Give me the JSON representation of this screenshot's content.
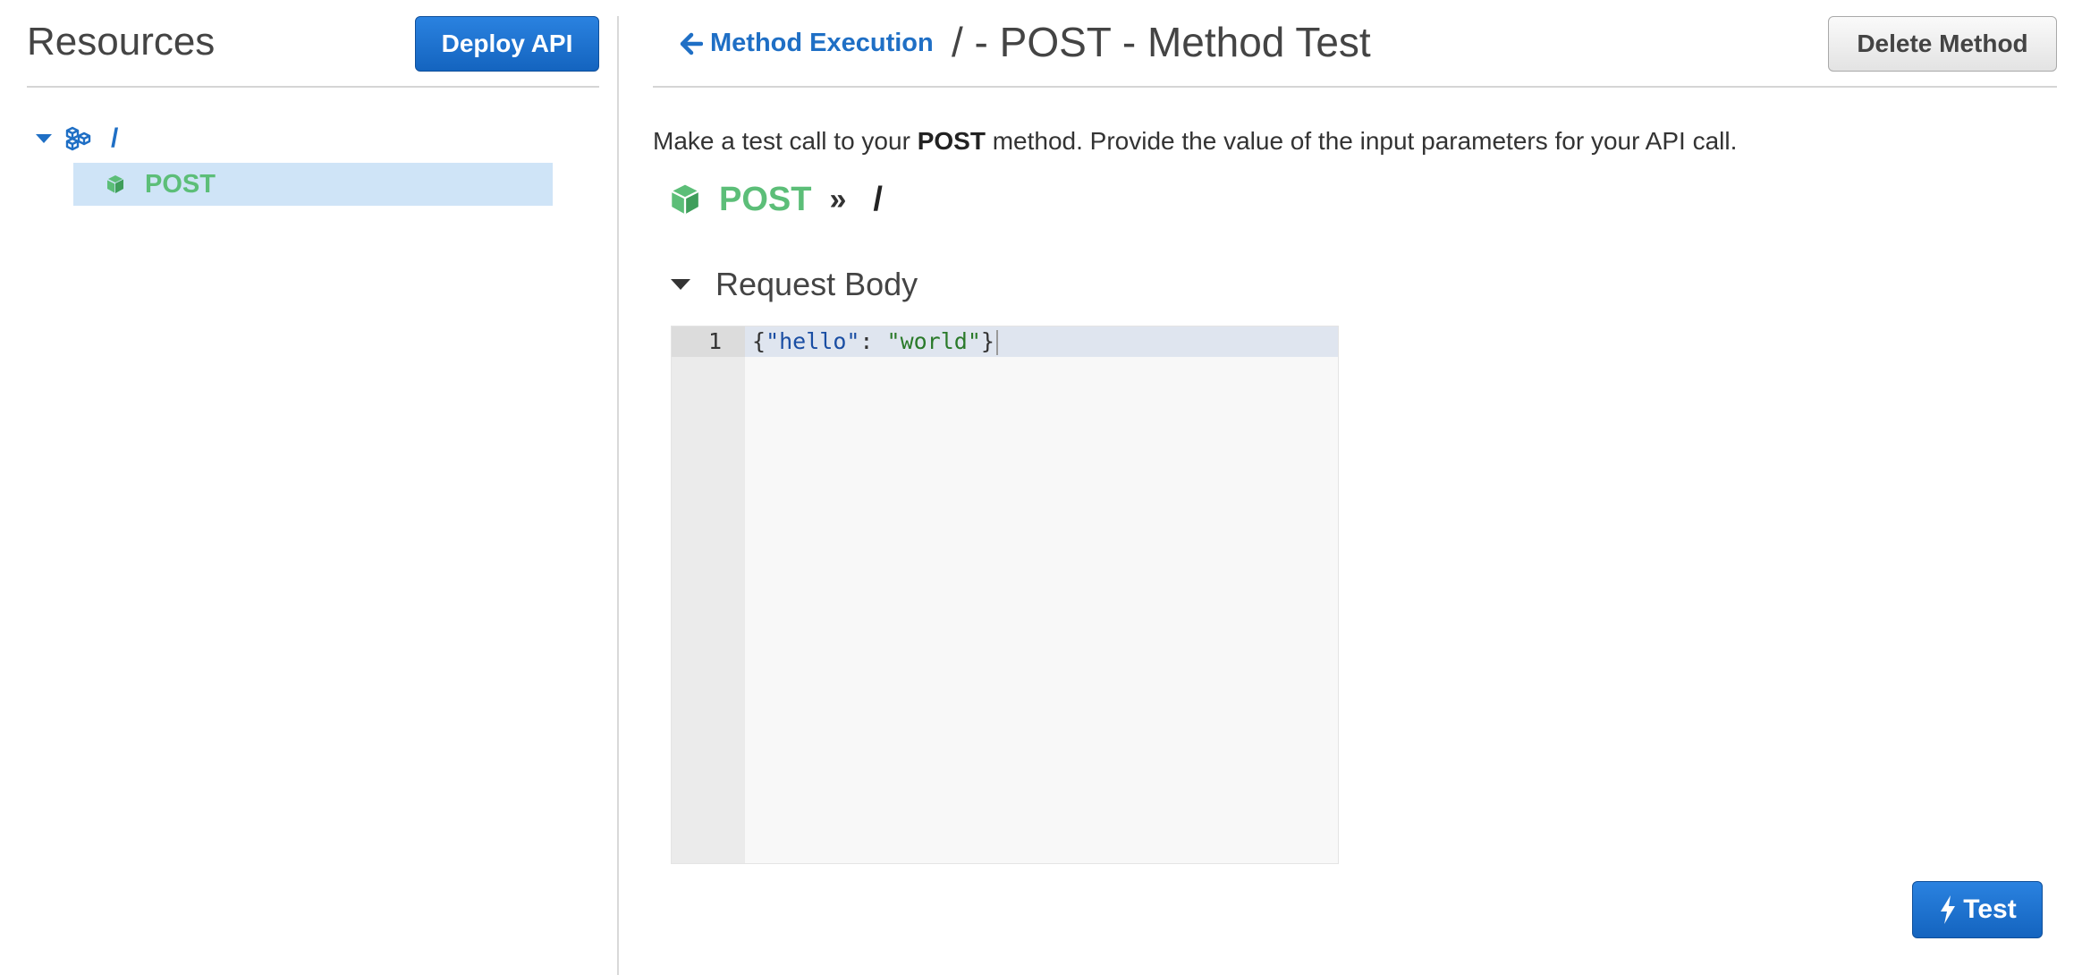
{
  "sidebar": {
    "title": "Resources",
    "deploy_button": "Deploy API",
    "tree": {
      "root": {
        "label": "/",
        "icon": "resources-cubes-icon",
        "expanded": true
      },
      "children": [
        {
          "label": "POST",
          "icon": "method-cube-icon",
          "selected": true
        }
      ]
    }
  },
  "header": {
    "back_link": "Method Execution",
    "title": "/ - POST - Method Test",
    "delete_button": "Delete Method"
  },
  "intro": {
    "prefix": "Make a test call to your ",
    "method": "POST",
    "suffix": " method. Provide the value of the input parameters for your API call."
  },
  "method_path": {
    "verb": "POST",
    "separator": "»",
    "resource": "/"
  },
  "request_body": {
    "section_title": "Request Body",
    "lines": [
      {
        "number": "1",
        "open": "{",
        "key": "\"hello\"",
        "colon": ": ",
        "value": "\"world\"",
        "close": "}"
      }
    ]
  },
  "test_button": "Test",
  "colors": {
    "primary": "#1464bf",
    "link": "#1f6fc5",
    "method_green": "#5cbe78",
    "selection": "#cfe4f7"
  }
}
